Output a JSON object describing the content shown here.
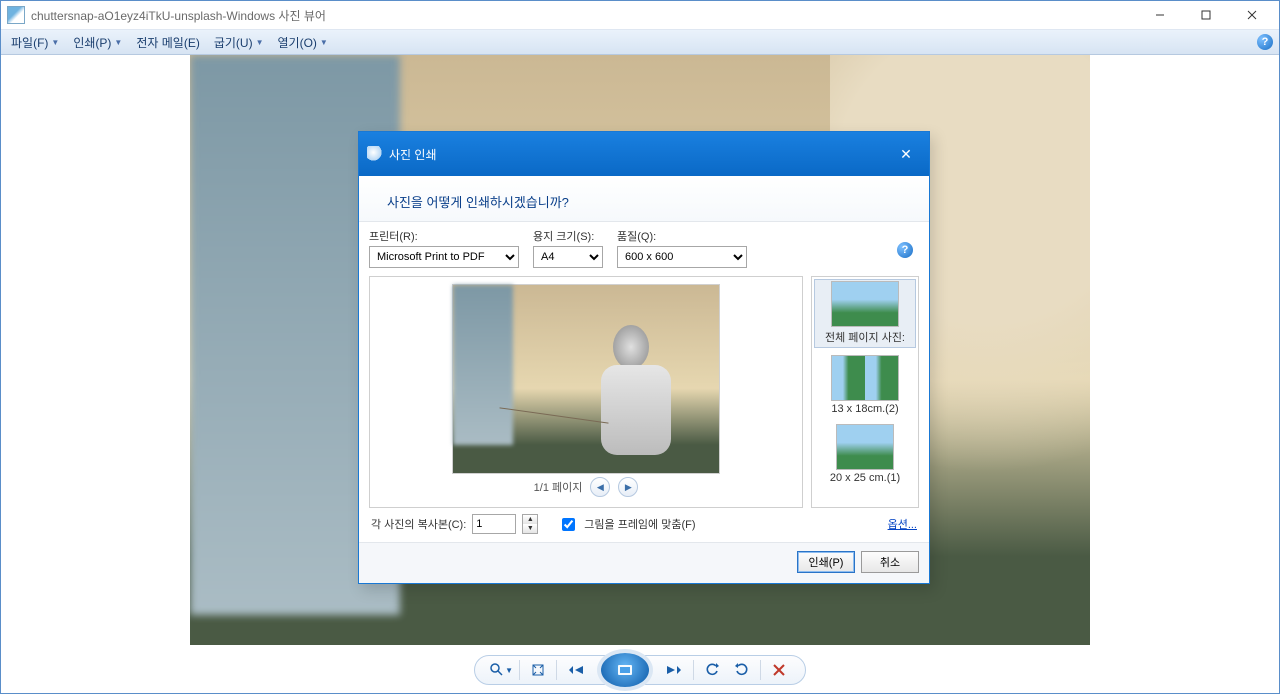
{
  "window": {
    "title": "chuttersnap-aO1eyz4iTkU-unsplash-Windows 사진 뷰어"
  },
  "menu": {
    "file": "파일(F)",
    "print": "인쇄(P)",
    "email": "전자 메일(E)",
    "burn": "굽기(U)",
    "open": "열기(O)"
  },
  "dialog": {
    "title": "사진 인쇄",
    "subtitle": "사진을 어떻게 인쇄하시겠습니까?",
    "printer_label": "프린터(R):",
    "printer_value": "Microsoft Print to PDF",
    "paper_label": "용지 크기(S):",
    "paper_value": "A4",
    "quality_label": "품질(Q):",
    "quality_value": "600 x 600",
    "pager": "1/1 페이지",
    "layouts": {
      "full": "전체 페이지 사진:",
      "l2": "13 x 18cm.(2)",
      "l3": "20 x 25 cm.(1)"
    },
    "copies_label": "각 사진의 복사본(C):",
    "copies_value": "1",
    "fit_frame": "그림을 프레임에 맞춤(F)",
    "options": "옵션...",
    "print_btn": "인쇄(P)",
    "cancel_btn": "취소"
  }
}
